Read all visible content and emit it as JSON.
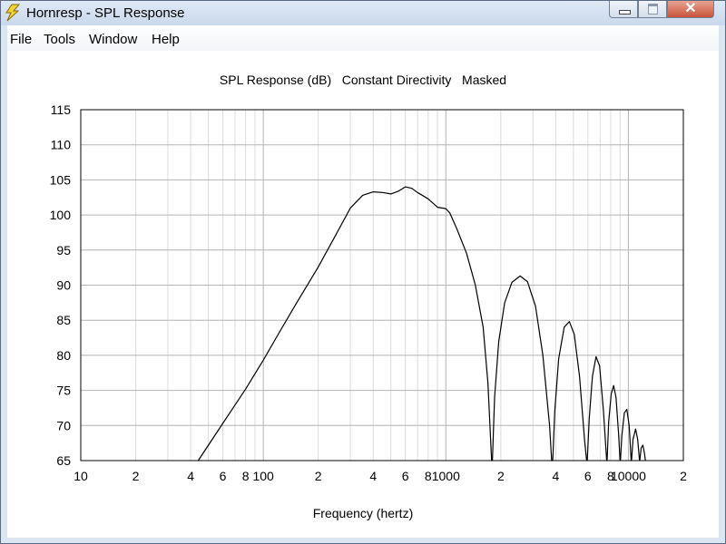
{
  "window": {
    "title": "Hornresp - SPL Response"
  },
  "menu": [
    {
      "label": "File"
    },
    {
      "label": "Tools"
    },
    {
      "label": "Window"
    },
    {
      "label": "Help"
    }
  ],
  "controls": {
    "close_glyph": "✕"
  },
  "chart_data": {
    "type": "line",
    "title": "SPL Response (dB)   Constant Directivity   Masked",
    "xlabel": "Frequency (hertz)",
    "ylabel": "",
    "xscale": "log",
    "xlim": [
      10,
      20000
    ],
    "ylim": [
      65,
      115
    ],
    "grid": true,
    "y_ticks": [
      65,
      70,
      75,
      80,
      85,
      90,
      95,
      100,
      105,
      110,
      115
    ],
    "x_tick_labels": [
      {
        "value": 10,
        "label": "10"
      },
      {
        "value": 20,
        "label": "2"
      },
      {
        "value": 40,
        "label": "4"
      },
      {
        "value": 60,
        "label": "6"
      },
      {
        "value": 80,
        "label": "8"
      },
      {
        "value": 100,
        "label": "100"
      },
      {
        "value": 200,
        "label": "2"
      },
      {
        "value": 400,
        "label": "4"
      },
      {
        "value": 600,
        "label": "6"
      },
      {
        "value": 800,
        "label": "8"
      },
      {
        "value": 1000,
        "label": "1000"
      },
      {
        "value": 2000,
        "label": "2"
      },
      {
        "value": 4000,
        "label": "4"
      },
      {
        "value": 6000,
        "label": "6"
      },
      {
        "value": 8000,
        "label": "8"
      },
      {
        "value": 10000,
        "label": "10000"
      },
      {
        "value": 20000,
        "label": "2"
      }
    ],
    "series": [
      {
        "color": "#000000",
        "points": [
          [
            44,
            65
          ],
          [
            60,
            70.3
          ],
          [
            80,
            75.2
          ],
          [
            100,
            79.3
          ],
          [
            120,
            82.9
          ],
          [
            150,
            87.2
          ],
          [
            200,
            92.6
          ],
          [
            250,
            97.2
          ],
          [
            300,
            101.0
          ],
          [
            350,
            102.8
          ],
          [
            400,
            103.3
          ],
          [
            450,
            103.2
          ],
          [
            500,
            103.0
          ],
          [
            550,
            103.4
          ],
          [
            600,
            104.0
          ],
          [
            650,
            103.8
          ],
          [
            700,
            103.2
          ],
          [
            800,
            102.3
          ],
          [
            900,
            101.1
          ],
          [
            1000,
            100.9
          ],
          [
            1050,
            100.3
          ],
          [
            1150,
            98.0
          ],
          [
            1300,
            94.5
          ],
          [
            1450,
            90.0
          ],
          [
            1600,
            84.0
          ],
          [
            1700,
            76.0
          ],
          [
            1780,
            65
          ],
          [
            1800,
            65
          ],
          [
            1850,
            74.0
          ],
          [
            1950,
            82.0
          ],
          [
            2100,
            87.5
          ],
          [
            2300,
            90.4
          ],
          [
            2550,
            91.3
          ],
          [
            2800,
            90.5
          ],
          [
            3100,
            87.0
          ],
          [
            3400,
            80.0
          ],
          [
            3700,
            70.0
          ],
          [
            3800,
            65
          ],
          [
            3850,
            65
          ],
          [
            3950,
            72.0
          ],
          [
            4150,
            79.5
          ],
          [
            4450,
            84.0
          ],
          [
            4750,
            84.8
          ],
          [
            5050,
            83.0
          ],
          [
            5400,
            77.0
          ],
          [
            5750,
            68.0
          ],
          [
            5900,
            65
          ],
          [
            5950,
            65
          ],
          [
            6100,
            71.0
          ],
          [
            6350,
            77.0
          ],
          [
            6650,
            79.8
          ],
          [
            6950,
            78.5
          ],
          [
            7300,
            72.0
          ],
          [
            7600,
            65
          ],
          [
            7650,
            65
          ],
          [
            7800,
            70.5
          ],
          [
            8050,
            74.5
          ],
          [
            8300,
            75.7
          ],
          [
            8550,
            74.0
          ],
          [
            8850,
            68.5
          ],
          [
            9000,
            65
          ],
          [
            9050,
            65
          ],
          [
            9200,
            68.5
          ],
          [
            9500,
            71.8
          ],
          [
            9800,
            72.3
          ],
          [
            10100,
            70.0
          ],
          [
            10350,
            65
          ],
          [
            10400,
            65
          ],
          [
            10600,
            68.0
          ],
          [
            10950,
            69.5
          ],
          [
            11250,
            68.0
          ],
          [
            11500,
            65
          ],
          [
            11550,
            65
          ],
          [
            11750,
            66.8
          ],
          [
            12000,
            67.2
          ],
          [
            12250,
            66.0
          ],
          [
            12400,
            65
          ]
        ]
      }
    ]
  }
}
